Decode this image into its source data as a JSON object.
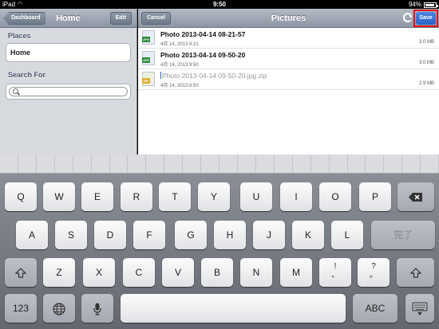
{
  "status": {
    "device": "iPad",
    "time": "9:50",
    "battery": "94%",
    "battery_level": 0.94
  },
  "left_nav": {
    "back_label": "Dashboard",
    "title": "Home",
    "edit_label": "Edit"
  },
  "places": {
    "header": "Places",
    "items": [
      "Home"
    ]
  },
  "search": {
    "header": "Search For",
    "value": ""
  },
  "right_nav": {
    "cancel_label": "Cancel",
    "title": "Pictures",
    "save_label": "Save"
  },
  "files": [
    {
      "name": "Photo 2013-04-14 08-21-57",
      "date": "4月 14, 2013 8:21",
      "size": "3.0 MB",
      "type": "JPG"
    },
    {
      "name": "Photo 2013-04-14 09-50-20",
      "date": "4月 14, 2013 9:50",
      "size": "3.0 MB",
      "type": "JPG"
    },
    {
      "name": "Photo 2013-04-14 09-50-20.jpg.zip",
      "date": "4月 14, 2013 9:50",
      "size": "2.9 MB",
      "type": "ZIP"
    }
  ],
  "keyboard": {
    "row1": [
      "Q",
      "W",
      "E",
      "R",
      "T",
      "Y",
      "U",
      "I",
      "O",
      "P"
    ],
    "row2": [
      "A",
      "S",
      "D",
      "F",
      "G",
      "H",
      "J",
      "K",
      "L"
    ],
    "done_label": "完了",
    "row3": [
      "Z",
      "X",
      "C",
      "V",
      "B",
      "N",
      "M"
    ],
    "excl_top": "!",
    "excl_bottom": "、",
    "quest_top": "?",
    "quest_bottom": "。",
    "numbers_label": "123",
    "abc_label": "ABC"
  }
}
